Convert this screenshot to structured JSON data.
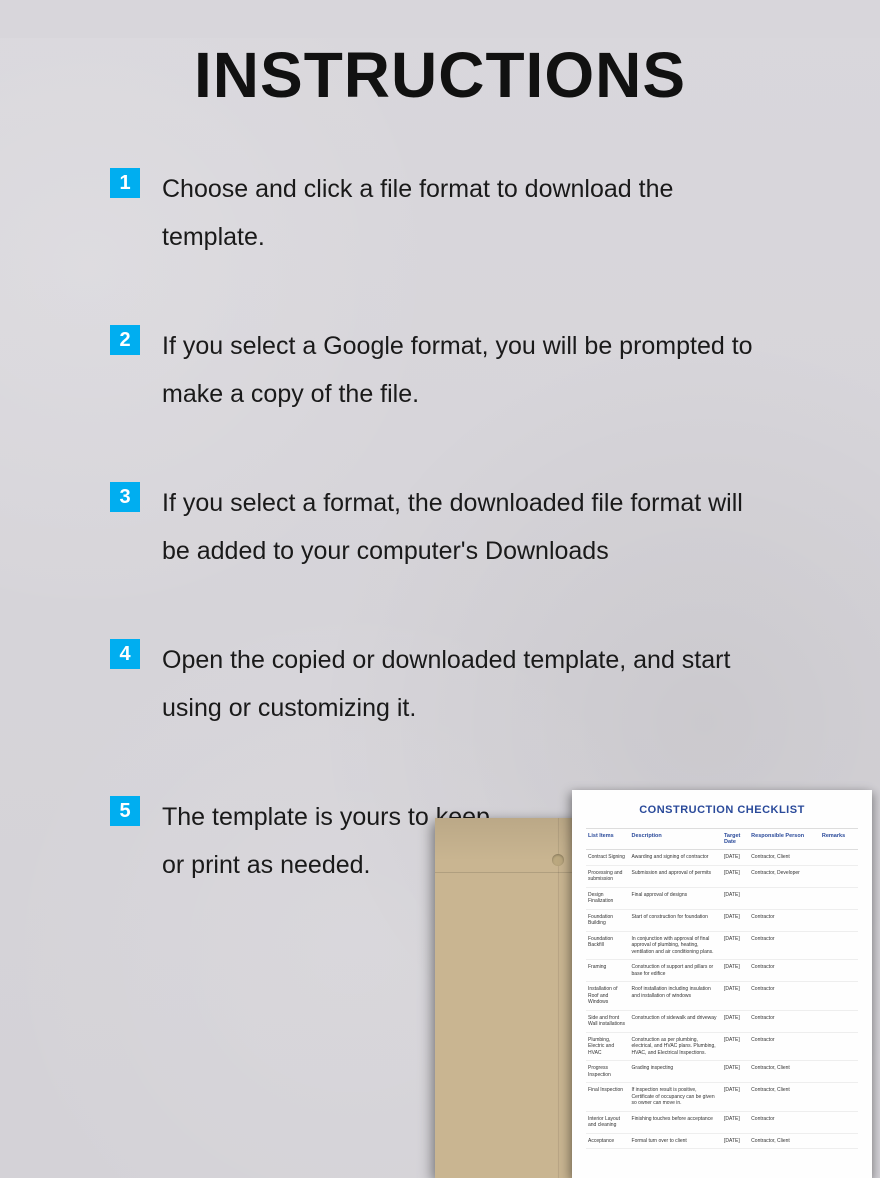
{
  "title": "INSTRUCTIONS",
  "steps": [
    {
      "num": "1",
      "text": "Choose and click a file format to download the template."
    },
    {
      "num": "2",
      "text": "If you select a Google format, you will be prompted to make a copy of the file."
    },
    {
      "num": "3",
      "text": "If you select a format, the downloaded file format will be added to your computer's Downloads"
    },
    {
      "num": "4",
      "text": "Open the copied or downloaded template, and start using or customizing it."
    },
    {
      "num": "5",
      "text": "The template is yours to keep or print as needed."
    }
  ],
  "preview": {
    "title": "CONSTRUCTION CHECKLIST",
    "headers": [
      "List Items",
      "Description",
      "Target Date",
      "Responsible Person",
      "Remarks"
    ],
    "rows": [
      [
        "Contract Signing",
        "Awarding and signing of contractor",
        "[DATE]",
        "Contractor, Client",
        ""
      ],
      [
        "Processing and submission",
        "Submission and approval of permits",
        "[DATE]",
        "Contractor, Developer",
        ""
      ],
      [
        "Design Finalization",
        "Final approval of designs",
        "[DATE]",
        "",
        ""
      ],
      [
        "Foundation Building",
        "Start of construction for foundation",
        "[DATE]",
        "Contractor",
        ""
      ],
      [
        "Foundation Backfill",
        "In conjunction with approval of final approval of plumbing, heating, ventilation and air conditioning plans.",
        "[DATE]",
        "Contractor",
        ""
      ],
      [
        "Framing",
        "Construction of support and pillars or base for edifice",
        "[DATE]",
        "Contractor",
        ""
      ],
      [
        "Installation of Roof and Windows",
        "Roof installation including insulation and installation of windows",
        "[DATE]",
        "Contractor",
        ""
      ],
      [
        "Side and front Wall installations",
        "Construction of sidewalk and driveway",
        "[DATE]",
        "Contractor",
        ""
      ],
      [
        "Plumbing, Electric and HVAC",
        "Construction as per plumbing, electrical, and HVAC plans. Plumbing, HVAC, and Electrical Inspections.",
        "[DATE]",
        "Contractor",
        ""
      ],
      [
        "Progress Inspection",
        "Grading inspecting",
        "[DATE]",
        "Contractor, Client",
        ""
      ],
      [
        "Final Inspection",
        "If inspection result is positive, Certificate of occupancy can be given so owner can move in.",
        "[DATE]",
        "Contractor, Client",
        ""
      ],
      [
        "Interior Layout and cleaning",
        "Finishing touches before acceptance",
        "[DATE]",
        "Contractor",
        ""
      ],
      [
        "Acceptance",
        "Formal turn over to client",
        "[DATE]",
        "Contractor, Client",
        ""
      ]
    ]
  }
}
